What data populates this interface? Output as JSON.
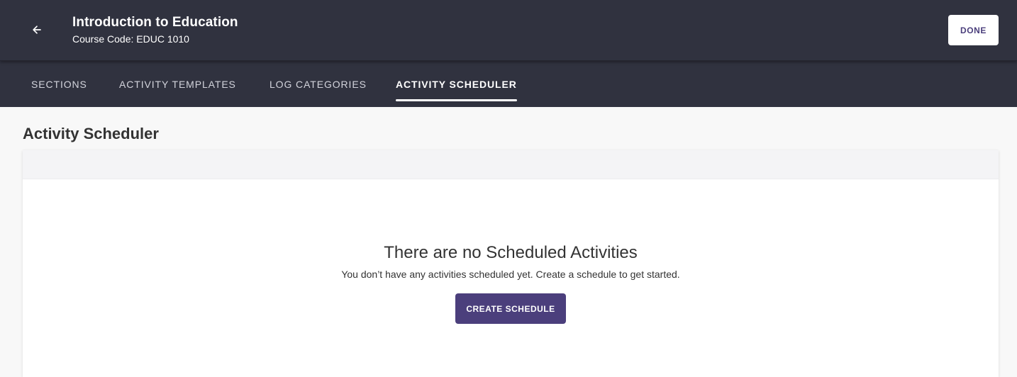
{
  "header": {
    "back_icon": "arrow-left-icon",
    "course_title": "Introduction to Education",
    "course_code": "Course Code: EDUC 1010",
    "done_label": "DONE"
  },
  "tabs": [
    {
      "label": "SECTIONS",
      "active": false
    },
    {
      "label": "ACTIVITY TEMPLATES",
      "active": false
    },
    {
      "label": "LOG CATEGORIES",
      "active": false
    },
    {
      "label": "ACTIVITY SCHEDULER",
      "active": true
    }
  ],
  "main": {
    "page_title": "Activity Scheduler",
    "empty_title": "There are no Scheduled Activities",
    "empty_description": "You don’t have any activities scheduled yet. Create a schedule to get started.",
    "create_label": "CREATE SCHEDULE"
  },
  "colors": {
    "header_bg": "#30323f",
    "accent": "#4b3f7c",
    "page_bg": "#f8f8f8"
  }
}
